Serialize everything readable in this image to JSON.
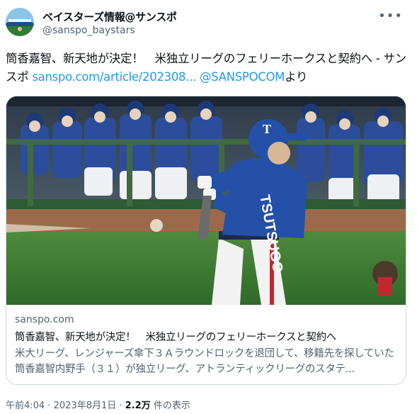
{
  "author": {
    "display_name": "ベイスターズ情報@サンスポ",
    "handle": "@sanspo_baystars",
    "more_icon": "more-horizontal-icon"
  },
  "tweet": {
    "text_main": "筒香嘉智、新天地が決定！　米独立リーグのフェリーホークスと契約へ - サンスポ ",
    "link_text": "sanspo.com/article/202308...",
    "space": " ",
    "mention": "@SANSPOCOM",
    "text_suffix": "より"
  },
  "card": {
    "domain": "sanspo.com",
    "title": "筒香嘉智、新天地が決定！　米独立リーグのフェリーホークスと契約へ",
    "description": "米大リーグ、レンジャーズ傘下３Ａラウンドロックを退団して、移籍先を探していた筒香嘉智内野手（３１）が独立リーグ、アトランティックリーグのスタテ..."
  },
  "meta": {
    "time": "午前4:04",
    "separator": " · ",
    "date": "2023年8月1日",
    "views_count": "2.2万",
    "views_label": " 件の表示"
  },
  "colors": {
    "link": "#1d9bf0",
    "secondary_text": "#536471",
    "border": "#cfd9de"
  }
}
